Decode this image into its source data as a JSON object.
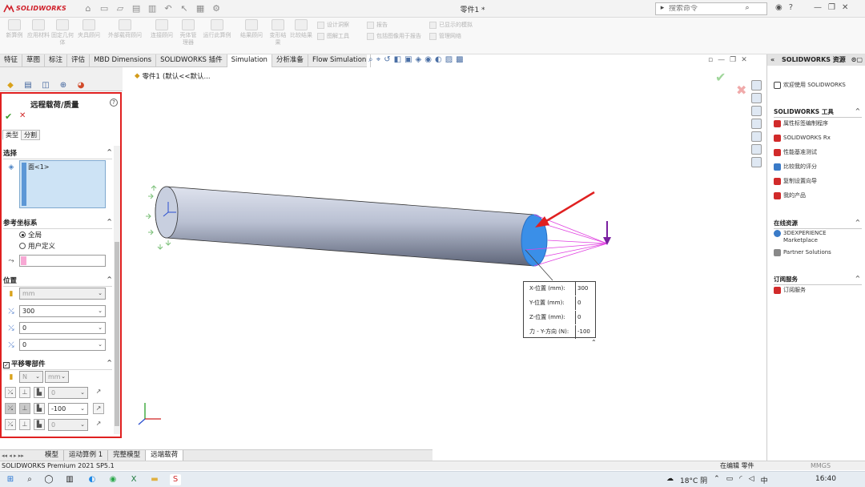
{
  "app": {
    "brand": "SOLIDWORKS",
    "doc_title": "零件1 *",
    "search_placeholder": "搜索命令"
  },
  "ribbon": {
    "buttons": [
      "新算例",
      "应用材料",
      "固定几何体",
      "夹具顾问",
      "外部载荷顾问",
      "连接顾问",
      "壳体管理器",
      "运行此算例",
      "结果顾问",
      "变形结果",
      "比较结果"
    ],
    "small": [
      "设计洞察",
      "图解工具",
      "报告",
      "包括图像用于报告",
      "已显示的模拟",
      "管理网络"
    ]
  },
  "tabs": [
    "特征",
    "草图",
    "标注",
    "评估",
    "MBD Dimensions",
    "SOLIDWORKS 插件",
    "Simulation",
    "分析准备",
    "Flow Simulation"
  ],
  "active_tab": "Simulation",
  "panel": {
    "title": "远程载荷/质量",
    "tabs": [
      "类型",
      "分割"
    ],
    "sections": {
      "selection": "选择",
      "ref_coords": "参考坐标系",
      "location": "位置",
      "translational": "平移零部件"
    },
    "selection_item": "面<1>",
    "radio_global": "全局",
    "radio_user": "用户定义",
    "location_unit": "mm",
    "x_value": "300",
    "y_value": "0",
    "z_value": "0",
    "force_unit": "N",
    "length_unit": "mm",
    "fx_value": "0",
    "fy_value": "-100",
    "fz_value": "0"
  },
  "viewport": {
    "breadcrumb_part": "零件1",
    "breadcrumb_config": "(默认<<默认..."
  },
  "readout": {
    "rows": [
      {
        "label": "X-位置 (mm):",
        "value": "300"
      },
      {
        "label": "Y-位置 (mm):",
        "value": "0"
      },
      {
        "label": "Z-位置 (mm):",
        "value": "0"
      },
      {
        "label": "力 - Y-方向 (N):",
        "value": "-100"
      }
    ]
  },
  "bottom_tabs": [
    "模型",
    "运动算例 1",
    "完整模型",
    "远端载荷"
  ],
  "status": {
    "left": "SOLIDWORKS Premium 2021 SP5.1",
    "middle": "在编辑 零件",
    "right": "MMGS"
  },
  "resources": {
    "title": "SOLIDWORKS 资源",
    "welcome": "欢迎使用 SOLIDWORKS",
    "tools_head": "SOLIDWORKS 工具",
    "tools": [
      "属性标签编制程序",
      "SOLIDWORKS Rx",
      "性能基准测试",
      "比较我的评分",
      "复制设置向导",
      "我的产品"
    ],
    "online_head": "在线资源",
    "online": [
      "3DEXPERIENCE Marketplace",
      "Partner Solutions"
    ],
    "sub_head": "订阅服务",
    "sub": [
      "订阅服务"
    ]
  },
  "taskbar": {
    "weather": "18°C 阴",
    "ime": "中",
    "time": "16:40"
  },
  "colors": {
    "accent_red": "#e02020",
    "model_face": "#3a8fe8",
    "load_line": "#e040e0"
  }
}
